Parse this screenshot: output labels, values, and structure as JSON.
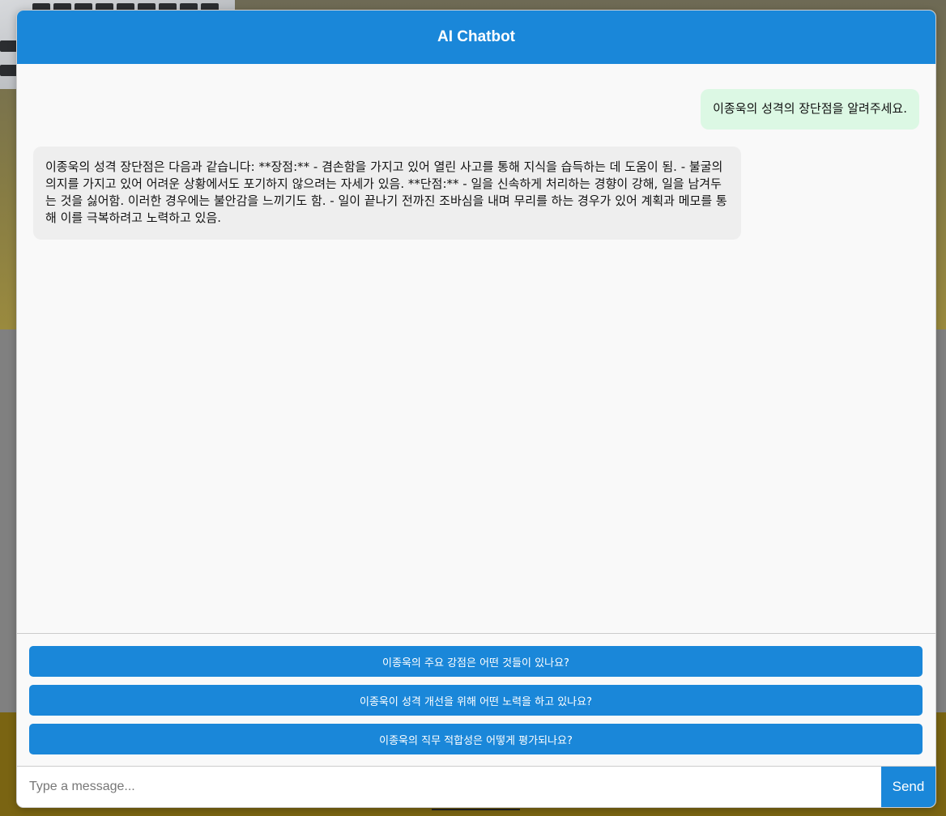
{
  "header": {
    "title": "AI Chatbot"
  },
  "messages": [
    {
      "role": "user",
      "text": "이종욱의 성격의 장단점을 알려주세요."
    },
    {
      "role": "bot",
      "text": "이종욱의 성격 장단점은 다음과 같습니다: **장점:** - 겸손함을 가지고 있어 열린 사고를 통해 지식을 습득하는 데 도움이 됨. - 불굴의 의지를 가지고 있어 어려운 상황에서도 포기하지 않으려는 자세가 있음. **단점:** - 일을 신속하게 처리하는 경향이 강해, 일을 남겨두는 것을 싫어함. 이러한 경우에는 불안감을 느끼기도 함. - 일이 끝나기 전까진 조바심을 내며 무리를 하는 경우가 있어 계획과 메모를 통해 이를 극복하려고 노력하고 있음."
    }
  ],
  "suggestions": [
    "이종욱의 주요 강점은 어떤 것들이 있나요?",
    "이종욱이 성격 개선을 위해 어떤 노력을 하고 있나요?",
    "이종욱의 직무 적합성은 어떻게 평가되나요?"
  ],
  "input": {
    "placeholder": "Type a message...",
    "value": "",
    "send_label": "Send"
  },
  "colors": {
    "accent": "#1a87d9",
    "user_bubble": "#dcf8e4",
    "bot_bubble": "#eeeeee"
  }
}
